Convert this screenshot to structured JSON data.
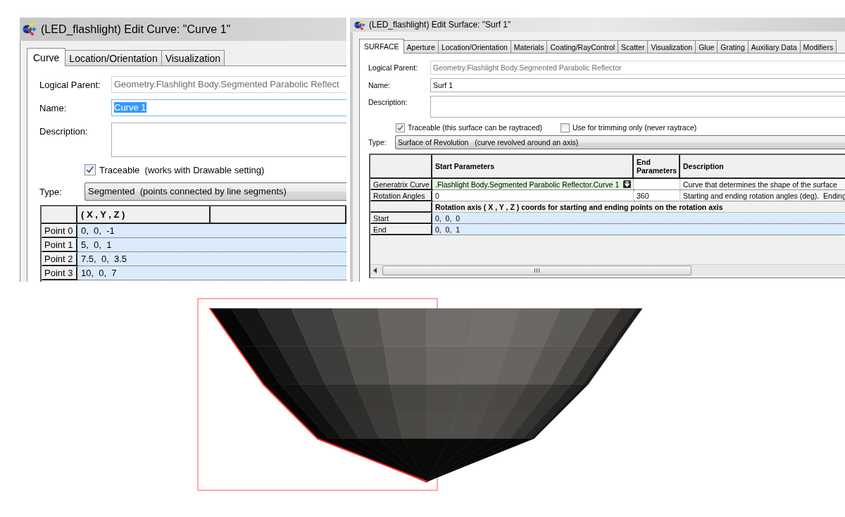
{
  "curve_dialog": {
    "title": "(LED_flashlight) Edit Curve: \"Curve 1\"",
    "tabs": [
      {
        "label": "Curve",
        "selected": true
      },
      {
        "label": "Location/Orientation",
        "selected": false
      },
      {
        "label": "Visualization",
        "selected": false
      }
    ],
    "fields": [
      {
        "kind": "line",
        "label": "Logical Parent:",
        "value": "Geometry.Flashlight Body.Segmented Parabolic Reflect",
        "disabled": true,
        "highlighted": false
      },
      {
        "kind": "line",
        "label": "Name:",
        "value": "Curve 1",
        "disabled": false,
        "highlighted": true
      },
      {
        "kind": "multiline",
        "label": "Description:",
        "disabled": false,
        "highlighted": false
      }
    ],
    "checkboxes": [
      {
        "label": "Traceable  (works with Drawable setting)",
        "checked": true
      }
    ],
    "type": {
      "label": "Type:",
      "value": "Segmented  (points connected by line segments)"
    },
    "grid": {
      "columns": [
        "( X , Y , Z )"
      ],
      "rows": [
        {
          "label": "Point 0",
          "value": "0,  0,  -1"
        },
        {
          "label": "Point 1",
          "value": "5,  0,  1"
        },
        {
          "label": "Point 2",
          "value": "7.5,  0,  3.5"
        },
        {
          "label": "Point 3",
          "value": "10,  0,  7"
        }
      ]
    }
  },
  "surface_dialog": {
    "title": "(LED_flashlight) Edit Surface: \"Surf 1\"",
    "tabs": [
      {
        "label": "SURFACE",
        "selected": true
      },
      {
        "label": "Aperture",
        "selected": false
      },
      {
        "label": "Location/Orientation",
        "selected": false
      },
      {
        "label": "Materials",
        "selected": false
      },
      {
        "label": "Coating/RayControl",
        "selected": false
      },
      {
        "label": "Scatter",
        "selected": false
      },
      {
        "label": "Visualization",
        "selected": false
      },
      {
        "label": "Glue",
        "selected": false
      },
      {
        "label": "Grating",
        "selected": false
      },
      {
        "label": "Auxiliary Data",
        "selected": false
      },
      {
        "label": "Modifiers",
        "selected": false
      }
    ],
    "fields": [
      {
        "kind": "line",
        "label": "Logical Parent:",
        "value": "Geometry.Flashlight Body.Segmented Parabolic Reflector",
        "disabled": true
      },
      {
        "kind": "line",
        "label": "Name:",
        "value": "Surf 1",
        "disabled": false
      },
      {
        "kind": "multiline",
        "label": "Description:",
        "disabled": false
      }
    ],
    "checkboxes": [
      {
        "label": "Traceable (this surface can be raytraced)",
        "checked": true
      },
      {
        "label": "Use for trimming only (never raytrace)",
        "checked": false
      }
    ],
    "type": {
      "label": "Type:",
      "value": "Surface of Revolution   (curve revolved around an axis)"
    },
    "grid": {
      "columns": [
        "Start Parameters",
        "End Parameters",
        "Description"
      ],
      "rows": [
        {
          "kind": "reference",
          "label": "Generatrix Curve",
          "start": ".Flashlight Body.Segmented Parabolic Reflector.Curve 1",
          "description": "Curve that determines the shape of the surface"
        },
        {
          "kind": "range",
          "label": "Rotation Angles",
          "start": "0",
          "end": "360",
          "description": "Starting and ending rotation angles (deg).  Ending"
        },
        {
          "kind": "section",
          "text": "Rotation axis ( X , Y , Z ) coords for starting and ending points on the rotation axis"
        },
        {
          "kind": "vector",
          "label": "Start",
          "value": "0,  0,  0"
        },
        {
          "kind": "vector",
          "label": "End",
          "value": "0,  0,  1"
        }
      ]
    }
  }
}
